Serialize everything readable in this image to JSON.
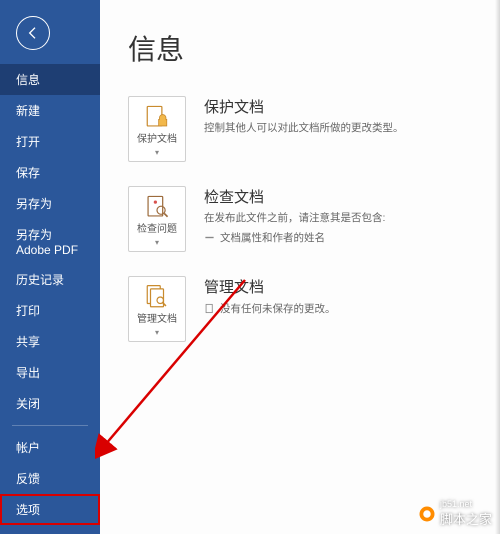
{
  "sidebar": {
    "items": [
      {
        "label": "信息",
        "selected": true
      },
      {
        "label": "新建"
      },
      {
        "label": "打开"
      },
      {
        "label": "保存"
      },
      {
        "label": "另存为"
      },
      {
        "label": "另存为 Adobe PDF"
      },
      {
        "label": "历史记录"
      },
      {
        "label": "打印"
      },
      {
        "label": "共享"
      },
      {
        "label": "导出"
      },
      {
        "label": "关闭"
      }
    ],
    "footer": [
      {
        "label": "帐户"
      },
      {
        "label": "反馈"
      },
      {
        "label": "选项",
        "highlighted": true
      }
    ]
  },
  "main": {
    "title": "信息",
    "sections": [
      {
        "tile_label": "保护文档",
        "title": "保护文档",
        "desc": "控制其他人可以对此文档所做的更改类型。"
      },
      {
        "tile_label": "检查问题",
        "title": "检查文档",
        "desc": "在发布此文件之前，请注意其是否包含:",
        "bullets": [
          "文档属性和作者的姓名"
        ]
      },
      {
        "tile_label": "管理文档",
        "title": "管理文档",
        "bullets": [
          "没有任何未保存的更改。"
        ]
      }
    ]
  },
  "watermark": {
    "text": "脚本之家",
    "url": "jb51.net"
  }
}
